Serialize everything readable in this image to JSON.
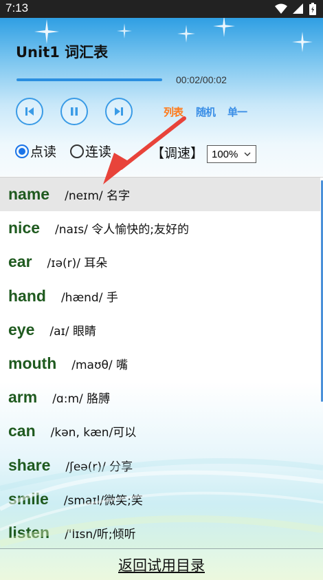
{
  "status": {
    "time": "7:13"
  },
  "header": {
    "title": "Unit1 词汇表",
    "progress": 0.99,
    "time_display": "00:02/00:02",
    "modes": [
      {
        "label": "列表",
        "color": "#ff7a1a"
      },
      {
        "label": "随机",
        "color": "#3a8ee6"
      },
      {
        "label": "单一",
        "color": "#3a8ee6"
      }
    ],
    "read_modes": [
      "点读",
      "连读"
    ],
    "read_mode_selected": "点读",
    "speed_label": "【调速】",
    "speed_value": "100%"
  },
  "words": [
    {
      "en": "name",
      "def": "/neɪm/ 名字",
      "selected": true
    },
    {
      "en": "nice",
      "def": "/naɪs/ 令人愉快的;友好的"
    },
    {
      "en": "ear",
      "def": "/ɪə(r)/ 耳朵"
    },
    {
      "en": "hand",
      "def": "/hænd/ 手"
    },
    {
      "en": "eye",
      "def": "/aɪ/ 眼睛"
    },
    {
      "en": "mouth",
      "def": "/maʊθ/ 嘴"
    },
    {
      "en": "arm",
      "def": "/ɑ:m/ 胳膊"
    },
    {
      "en": "can",
      "def": "/kən, kæn/可以"
    },
    {
      "en": "share",
      "def": "/ʃeə(r)/ 分享"
    },
    {
      "en": "smile",
      "def": "/smaɪl/微笑;笑"
    },
    {
      "en": "listen",
      "def": "/'lɪsn/听;倾听"
    }
  ],
  "footer": {
    "link": "返回试用目录"
  },
  "colors": {
    "accent": "#2a8ee0",
    "word_green": "#1f5a1f",
    "mode_active": "#ff7a1a",
    "arrow": "#e8433a"
  }
}
